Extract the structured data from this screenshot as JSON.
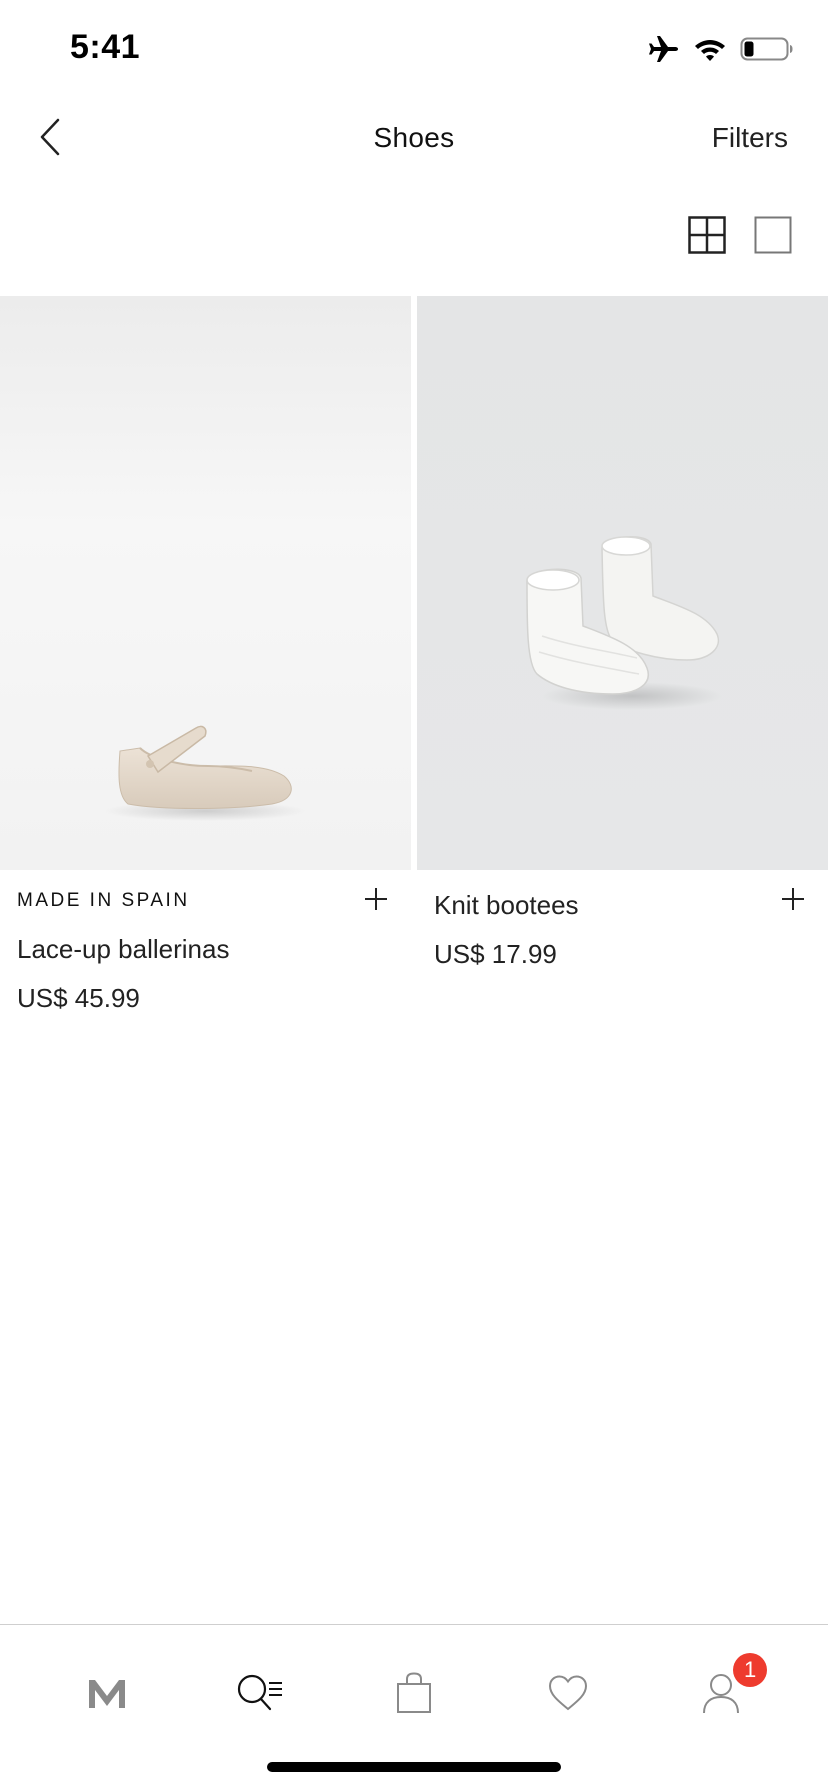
{
  "status_bar": {
    "time": "5:41",
    "icons": [
      "airplane-icon",
      "wifi-icon",
      "battery-icon"
    ]
  },
  "header": {
    "title": "Shoes",
    "filters_label": "Filters",
    "back_icon": "chevron-left-icon"
  },
  "view_toggle": {
    "options": [
      "grid-4-icon",
      "grid-1-icon"
    ]
  },
  "products": [
    {
      "tag": "MADE IN SPAIN",
      "name": "Lace-up ballerinas",
      "price": "US$ 45.99",
      "add_icon": "plus-icon"
    },
    {
      "tag": "",
      "name": "Knit bootees",
      "price": "US$ 17.99",
      "add_icon": "plus-icon"
    }
  ],
  "tab_bar": {
    "items": [
      "home-logo-icon",
      "search-menu-icon",
      "bag-icon",
      "heart-icon",
      "profile-icon"
    ],
    "badge": "1"
  },
  "colors": {
    "badge": "#ee3b2e",
    "text": "#111111",
    "divider": "#cfcfcf"
  }
}
